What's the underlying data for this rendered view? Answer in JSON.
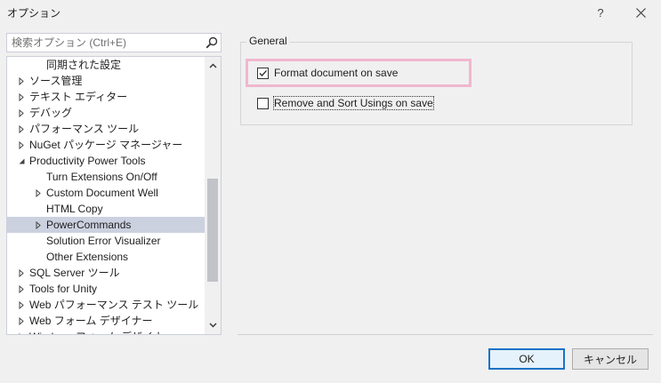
{
  "window": {
    "title": "オプション",
    "help_label": "?"
  },
  "search": {
    "placeholder": "検索オプション (Ctrl+E)"
  },
  "tree": {
    "items": [
      {
        "label": "同期された設定",
        "indent": 1,
        "expander": "none"
      },
      {
        "label": "ソース管理",
        "indent": 0,
        "expander": "collapsed"
      },
      {
        "label": "テキスト エディター",
        "indent": 0,
        "expander": "collapsed"
      },
      {
        "label": "デバッグ",
        "indent": 0,
        "expander": "collapsed"
      },
      {
        "label": "パフォーマンス ツール",
        "indent": 0,
        "expander": "collapsed"
      },
      {
        "label": "NuGet パッケージ マネージャー",
        "indent": 0,
        "expander": "collapsed"
      },
      {
        "label": "Productivity Power Tools",
        "indent": 0,
        "expander": "expanded"
      },
      {
        "label": "Turn Extensions On/Off",
        "indent": 1,
        "expander": "none"
      },
      {
        "label": "Custom Document Well",
        "indent": 1,
        "expander": "collapsed"
      },
      {
        "label": "HTML Copy",
        "indent": 1,
        "expander": "none"
      },
      {
        "label": "PowerCommands",
        "indent": 1,
        "expander": "collapsed",
        "selected": true
      },
      {
        "label": "Solution Error Visualizer",
        "indent": 1,
        "expander": "none"
      },
      {
        "label": "Other Extensions",
        "indent": 1,
        "expander": "none"
      },
      {
        "label": "SQL Server ツール",
        "indent": 0,
        "expander": "collapsed"
      },
      {
        "label": "Tools for Unity",
        "indent": 0,
        "expander": "collapsed"
      },
      {
        "label": "Web パフォーマンス テスト ツール",
        "indent": 0,
        "expander": "collapsed"
      },
      {
        "label": "Web フォーム デザイナー",
        "indent": 0,
        "expander": "collapsed"
      },
      {
        "label": "Windows フォーム デザイナー",
        "indent": 0,
        "expander": "collapsed"
      }
    ],
    "scroll_position": 0.45
  },
  "general": {
    "title": "General",
    "options": [
      {
        "label": "Format document on save",
        "checked": true
      },
      {
        "label": "Remove and Sort Usings on save",
        "checked": false
      }
    ]
  },
  "buttons": {
    "ok": "OK",
    "cancel": "キャンセル"
  },
  "colors": {
    "selection": "#ccd1e0",
    "highlight_border": "#f0b7ce",
    "ok_border": "#1c72c6"
  }
}
